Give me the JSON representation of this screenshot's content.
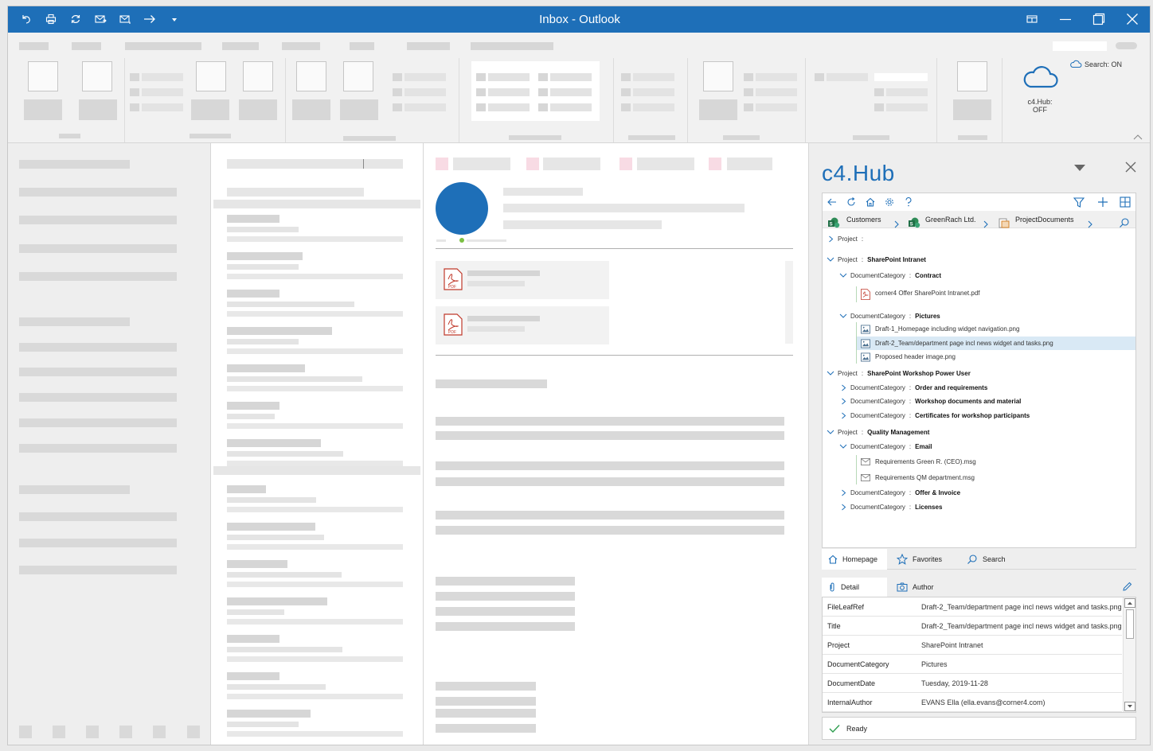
{
  "window": {
    "title": "Inbox - Outlook"
  },
  "quick_access": [
    "undo-icon",
    "print-icon",
    "refresh-icon",
    "send-receive-icon",
    "reply-all-icon",
    "forward-icon",
    "customize-icon"
  ],
  "ribbon": {
    "search_status": "Search: ON",
    "c4hub_label": "c4.Hub:",
    "c4hub_state": "OFF"
  },
  "c4hub": {
    "title": "c4.Hub",
    "breadcrumb": [
      "Customers",
      "GreenRach Ltd.",
      "ProjectDocuments"
    ],
    "tree": [
      {
        "indent": 0,
        "expanded": false,
        "label": "Project",
        "value": ""
      },
      {
        "indent": 0,
        "expanded": true,
        "label": "Project",
        "value": "SharePoint Intranet"
      },
      {
        "indent": 1,
        "expanded": true,
        "label": "DocumentCategory",
        "value": "Contract"
      },
      {
        "indent": 2,
        "file": "pdf",
        "name": "corner4 Offer SharePoint Intranet.pdf"
      },
      {
        "indent": 1,
        "expanded": true,
        "label": "DocumentCategory",
        "value": "Pictures"
      },
      {
        "indent": 2,
        "file": "img",
        "name": "Draft-1_Homepage including widget navigation.png"
      },
      {
        "indent": 2,
        "file": "img",
        "name": "Draft-2_Team/department page incl news widget and tasks.png",
        "selected": true
      },
      {
        "indent": 2,
        "file": "img",
        "name": "Proposed header image.png"
      },
      {
        "indent": 0,
        "expanded": true,
        "label": "Project",
        "value": "SharePoint Workshop Power User"
      },
      {
        "indent": 1,
        "expanded": false,
        "label": "DocumentCategory",
        "value": "Order and requirements"
      },
      {
        "indent": 1,
        "expanded": false,
        "label": "DocumentCategory",
        "value": "Workshop documents and material"
      },
      {
        "indent": 1,
        "expanded": false,
        "label": "DocumentCategory",
        "value": "Certificates for workshop participants"
      },
      {
        "indent": 0,
        "expanded": true,
        "label": "Project",
        "value": "Quality Management"
      },
      {
        "indent": 1,
        "expanded": true,
        "label": "DocumentCategory",
        "value": "Email"
      },
      {
        "indent": 2,
        "file": "mail",
        "name": "Requirements Green R. (CEO).msg"
      },
      {
        "indent": 2,
        "file": "mail",
        "name": "Requirements QM department.msg"
      },
      {
        "indent": 1,
        "expanded": false,
        "label": "DocumentCategory",
        "value": "Offer & Invoice"
      },
      {
        "indent": 1,
        "expanded": false,
        "label": "DocumentCategory",
        "value": "Licenses"
      }
    ],
    "nav_tabs": {
      "homepage": "Homepage",
      "favorites": "Favorites",
      "search": "Search"
    },
    "detail_tabs": {
      "detail": "Detail",
      "author": "Author"
    },
    "details": [
      {
        "key": "FileLeafRef",
        "value": "Draft-2_Team/department page incl news widget and tasks.png"
      },
      {
        "key": "Title",
        "value": "Draft-2_Team/department page incl news widget and tasks.png"
      },
      {
        "key": "Project",
        "value": "SharePoint Intranet"
      },
      {
        "key": "DocumentCategory",
        "value": "Pictures"
      },
      {
        "key": "DocumentDate",
        "value": "Tuesday, 2019-11-28"
      },
      {
        "key": "InternalAuthor",
        "value": "EVANS Ella (ella.evans@corner4.com)"
      }
    ],
    "status": "Ready"
  },
  "colors": {
    "accent": "#1e6fb8",
    "selected_row": "#d9e9f5",
    "pdf_red": "#c0392b",
    "status_green": "#2e9e4f"
  }
}
